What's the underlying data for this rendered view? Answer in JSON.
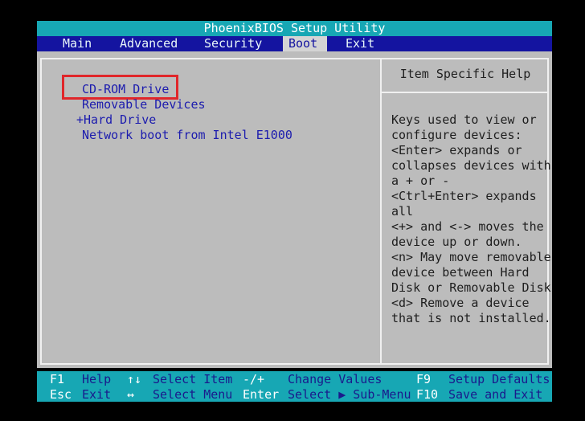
{
  "title": "PhoenixBIOS Setup Utility",
  "menu": [
    {
      "label": "Main"
    },
    {
      "label": "Advanced"
    },
    {
      "label": "Security"
    },
    {
      "label": "Boot",
      "active": true
    },
    {
      "label": "Exit"
    }
  ],
  "boot_order": [
    {
      "label": "CD-ROM Drive",
      "selected": true
    },
    {
      "label": "Removable Devices"
    },
    {
      "label": "+Hard Drive"
    },
    {
      "label": "Network boot from Intel E1000"
    }
  ],
  "help": {
    "title": "Item Specific Help",
    "lines": [
      "Keys used to view or",
      "configure devices:",
      "<Enter> expands or",
      "collapses devices with",
      "a + or -",
      "<Ctrl+Enter> expands",
      "all",
      "<+> and <-> moves the",
      "device up or down.",
      "<n> May move removable",
      "device between Hard",
      "Disk or Removable Disk",
      "<d> Remove a device",
      "that is not installed."
    ]
  },
  "footer": {
    "row1": [
      {
        "key": "F1",
        "desc": "Help"
      },
      {
        "key": "↑↓",
        "desc": "Select Item"
      },
      {
        "key": "-/+",
        "desc": "Change Values"
      },
      {
        "key": "F9",
        "desc": "Setup Defaults"
      }
    ],
    "row2": [
      {
        "key": "Esc",
        "desc": "Exit"
      },
      {
        "key": "↔",
        "desc": "Select Menu"
      },
      {
        "key": "Enter",
        "desc": "Select ▶ Sub-Menu"
      },
      {
        "key": "F10",
        "desc": "Save and Exit"
      }
    ]
  },
  "colors": {
    "title_bar": "#17a7b4",
    "menu_bar": "#1414a0",
    "panel_bg": "#bcbcbc",
    "item_text": "#1c1cae",
    "highlight_box": "#e0262a"
  }
}
